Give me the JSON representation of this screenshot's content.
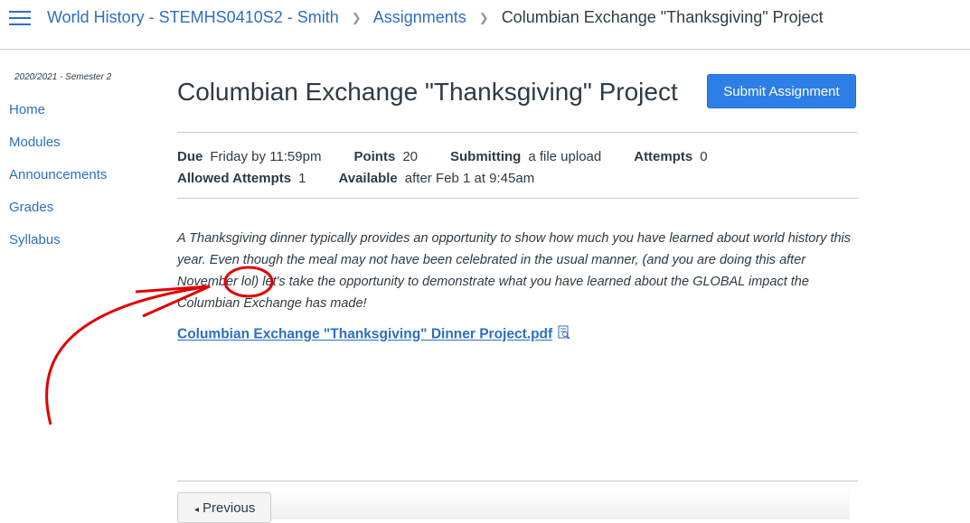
{
  "breadcrumb": {
    "course": "World History - STEMHS0410S2 - Smith",
    "section": "Assignments",
    "current": "Columbian Exchange \"Thanksgiving\" Project"
  },
  "sidebar": {
    "term": "2020/2021 - Semester 2",
    "items": [
      {
        "label": "Home"
      },
      {
        "label": "Modules"
      },
      {
        "label": "Announcements"
      },
      {
        "label": "Grades"
      },
      {
        "label": "Syllabus"
      }
    ]
  },
  "assignment": {
    "title": "Columbian Exchange \"Thanksgiving\" Project",
    "submit_label": "Submit Assignment",
    "details": {
      "due_label": "Due",
      "due_value": "Friday by 11:59pm",
      "points_label": "Points",
      "points_value": "20",
      "submitting_label": "Submitting",
      "submitting_value": "a file upload",
      "attempts_label": "Attempts",
      "attempts_value": "0",
      "allowed_label": "Allowed Attempts",
      "allowed_value": "1",
      "available_label": "Available",
      "available_value": "after Feb 1 at 9:45am"
    },
    "description": "A Thanksgiving dinner typically provides an opportunity to show how much you have learned about world history this year. Even though the meal may not have been celebrated in the usual manner, (and you are doing this after November lol) let's take the opportunity to demonstrate what you have learned about the GLOBAL impact the Columbian Exchange has made!",
    "file_link": "Columbian Exchange \"Thanksgiving\" Dinner Project.pdf"
  },
  "footer": {
    "previous_label": "Previous",
    "previous_glyph": "◂"
  },
  "colors": {
    "link": "#2d6fc0",
    "button": "#2d7ee6",
    "annotation": "#e00000"
  }
}
